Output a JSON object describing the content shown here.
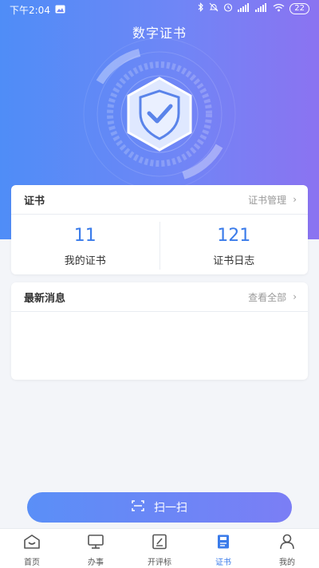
{
  "status_bar": {
    "time": "下午2:04",
    "battery": "22"
  },
  "header": {
    "title": "数字证书"
  },
  "certificate_card": {
    "title": "证书",
    "manage_link": "证书管理",
    "stats": [
      {
        "value": "11",
        "label": "我的证书"
      },
      {
        "value": "121",
        "label": "证书日志"
      }
    ]
  },
  "news_card": {
    "title": "最新消息",
    "view_all": "查看全部"
  },
  "scan_button": {
    "label": "扫一扫"
  },
  "tabbar": {
    "items": [
      {
        "label": "首页",
        "icon": "home-icon",
        "active": false
      },
      {
        "label": "办事",
        "icon": "monitor-icon",
        "active": false
      },
      {
        "label": "开评标",
        "icon": "edit-doc-icon",
        "active": false
      },
      {
        "label": "证书",
        "icon": "certificate-icon",
        "active": true
      },
      {
        "label": "我的",
        "icon": "user-icon",
        "active": false
      }
    ]
  },
  "colors": {
    "accent": "#3a7bea",
    "gradient_start": "#4f8df7",
    "gradient_end": "#8b73f1"
  }
}
